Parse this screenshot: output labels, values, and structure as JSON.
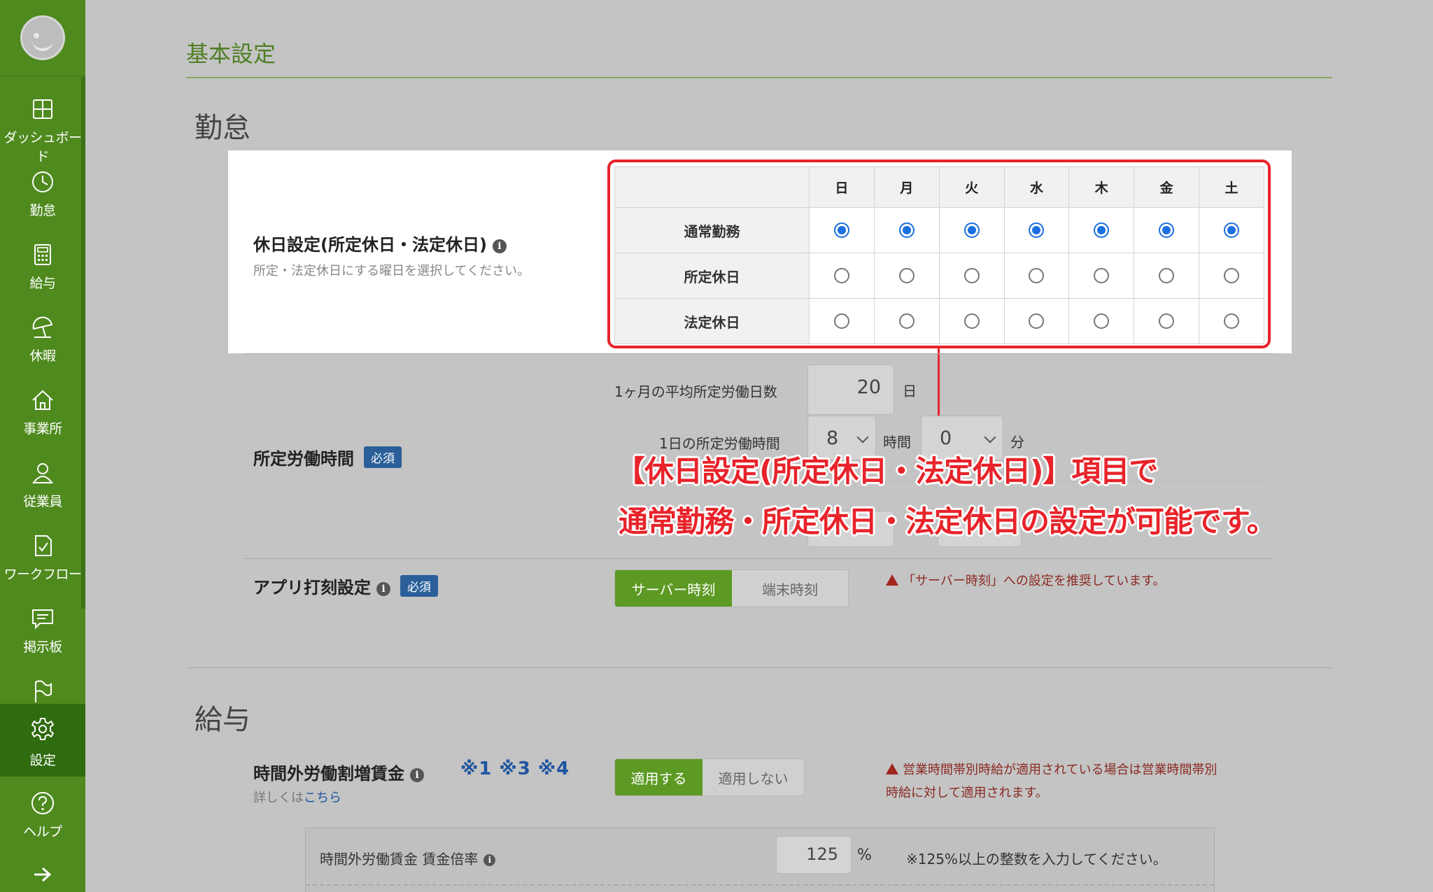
{
  "sidebar": {
    "items": [
      {
        "label": "ダッシュボード",
        "icon": "dashboard-icon"
      },
      {
        "label": "勤怠",
        "icon": "clock-icon"
      },
      {
        "label": "給与",
        "icon": "calculator-icon"
      },
      {
        "label": "休暇",
        "icon": "beach-umbrella-icon"
      },
      {
        "label": "事業所",
        "icon": "home-icon"
      },
      {
        "label": "従業員",
        "icon": "person-icon"
      },
      {
        "label": "ワークフロー",
        "icon": "checklist-icon"
      },
      {
        "label": "掲示板",
        "icon": "message-icon"
      },
      {
        "label": "",
        "icon": "flag-icon"
      },
      {
        "label": "設定",
        "icon": "gear-icon"
      },
      {
        "label": "ヘルプ",
        "icon": "help-icon"
      }
    ],
    "active": "設定"
  },
  "page": {
    "title": "基本設定"
  },
  "attendance": {
    "heading": "勤怠",
    "holiday": {
      "title": "休日設定(所定休日・法定休日)",
      "description": "所定・法定休日にする曜日を選択してください。",
      "days": [
        "日",
        "月",
        "火",
        "水",
        "木",
        "金",
        "土"
      ],
      "rows": [
        {
          "label": "通常勤務",
          "selected": [
            true,
            true,
            true,
            true,
            true,
            true,
            true
          ]
        },
        {
          "label": "所定休日",
          "selected": [
            false,
            false,
            false,
            false,
            false,
            false,
            false
          ]
        },
        {
          "label": "法定休日",
          "selected": [
            false,
            false,
            false,
            false,
            false,
            false,
            false
          ]
        }
      ]
    },
    "working_hours": {
      "title": "所定労働時間",
      "required": "必須",
      "monthly_days_label": "1ヶ月の平均所定労働日数",
      "monthly_days_value": "20",
      "monthly_days_unit": "日",
      "daily_hours_label": "1日の所定労働時間",
      "daily_hours_value": "8",
      "hours_unit": "時間",
      "daily_minutes_value": "0",
      "minutes_unit": "分"
    },
    "app_stamp": {
      "title": "アプリ打刻設定",
      "required": "必須",
      "options": [
        "サーバー時刻",
        "端末時刻"
      ],
      "selected": "サーバー時刻",
      "warning": "「サーバー時刻」への設定を推奨しています。"
    }
  },
  "callout": {
    "line1": "【休日設定(所定休日・法定休日)】項目で",
    "line2": "通常勤務・所定休日・法定休日の設定が可能です。"
  },
  "payroll": {
    "heading": "給与",
    "overtime": {
      "title": "時間外労働割増賃金",
      "notes": "※1  ※3  ※4",
      "details_prefix": "詳しくは",
      "details_link": "こちら",
      "options": [
        "適用する",
        "適用しない"
      ],
      "selected": "適用する",
      "warning_line1": "営業時間帯別時給が適用されている場合は営業時間帯別",
      "warning_line2": "時給に対して適用されます。",
      "rate_label": "時間外労働賃金 賃金倍率",
      "rate_value": "125",
      "rate_unit": "%",
      "rate_note": "※125%以上の整数を入力してください。"
    }
  },
  "colors": {
    "brand": "#4f8a1e",
    "accent": "#5c9a24",
    "radio": "#1b6fe0",
    "highlight": "#e8232a",
    "required": "#2a5f99"
  }
}
